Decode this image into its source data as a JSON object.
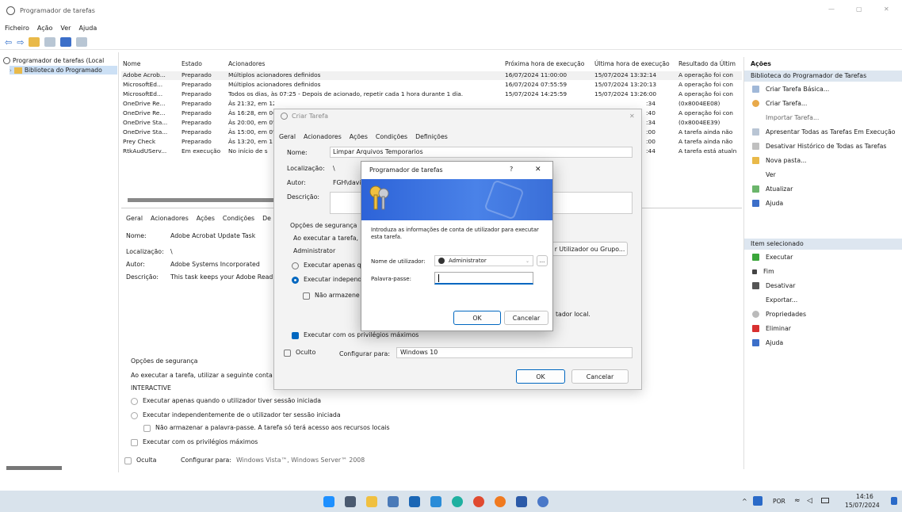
{
  "window": {
    "title": "Programador de tarefas",
    "min": "—",
    "restore": "▢",
    "close": "✕"
  },
  "menu": [
    "Ficheiro",
    "Ação",
    "Ver",
    "Ajuda"
  ],
  "tree": {
    "root": "Programador de tarefas (Local",
    "child": "Biblioteca do Programado"
  },
  "table": {
    "columns": [
      "Nome",
      "Estado",
      "Acionadores",
      "Próxima hora de execução",
      "Última hora de execução",
      "Resultado da Últim"
    ],
    "rows": [
      [
        "Adobe Acrob...",
        "Preparado",
        "Múltiplos acionadores definidos",
        "16/07/2024 11:00:00",
        "15/07/2024 13:32:14",
        "A operação foi con"
      ],
      [
        "MicrosoftEd...",
        "Preparado",
        "Múltiplos acionadores definidos",
        "16/07/2024 07:55:59",
        "15/07/2024 13:20:13",
        "A operação foi con"
      ],
      [
        "MicrosoftEd...",
        "Preparado",
        "Todos os dias, às 07:25 - Depois de acionado, repetir cada 1 hora durante 1 dia.",
        "15/07/2024 14:25:59",
        "15/07/2024 13:26:00",
        "A operação foi con"
      ],
      [
        "OneDrive Re...",
        "Preparado",
        "Às 21:32, em 12",
        "",
        ":34",
        "(0x8004EE08)"
      ],
      [
        "OneDrive Re...",
        "Preparado",
        "Às 16:28, em 0(",
        "",
        ":40",
        "A operação foi con"
      ],
      [
        "OneDrive Sta...",
        "Preparado",
        "Às 20:00, em 0'",
        "",
        ":34",
        "(0x8004EE39)"
      ],
      [
        "OneDrive Sta...",
        "Preparado",
        "Às 15:00, em 0'",
        "",
        ":00",
        "A tarefa ainda não"
      ],
      [
        "Prey Check",
        "Preparado",
        "Às 13:20, em 1!",
        "",
        ":00",
        "A tarefa ainda não"
      ],
      [
        "RtkAudUServ...",
        "Em execução",
        "No início de s",
        "",
        ":44",
        "A tarefa está atualn"
      ]
    ]
  },
  "lower": {
    "tabs": [
      "Geral",
      "Acionadores",
      "Ações",
      "Condições",
      "De"
    ],
    "name_label": "Nome:",
    "name_value": "Adobe Acrobat Update Task",
    "loc_label": "Localização:",
    "loc_value": "\\",
    "author_label": "Autor:",
    "author_value": "Adobe Systems Incorporated",
    "desc_label": "Descrição:",
    "desc_value": "This task keeps your Adobe Read",
    "sec_title": "Opções de segurança",
    "sec_text": "Ao executar a tarefa, utilizar a seguinte conta",
    "account": "INTERACTIVE",
    "opt1": "Executar apenas quando o utilizador tiver sessão iniciada",
    "opt2": "Executar independentemente de o utilizador ter sessão iniciada",
    "opt3": "Não armazenar a palavra-passe. A tarefa só terá acesso aos recursos locais",
    "opt4": "Executar com os privilégios máximos",
    "hidden": "Oculta",
    "config_label": "Configurar para:",
    "config_value": "Windows Vista™, Windows Server™ 2008"
  },
  "actions": {
    "title": "Ações",
    "section1": "Biblioteca do Programador de Tarefas",
    "items1": [
      "Criar Tarefa Básica...",
      "Criar Tarefa...",
      "Importar Tarefa...",
      "Apresentar Todas as Tarefas Em Execução",
      "Desativar Histórico de Todas as Tarefas",
      "Nova pasta...",
      "Ver",
      "Atualizar",
      "Ajuda"
    ],
    "section2": "Item selecionado",
    "items2": [
      "Executar",
      "Fim",
      "Desativar",
      "Exportar...",
      "Propriedades",
      "Eliminar",
      "Ajuda"
    ]
  },
  "criar": {
    "title": "Criar Tarefa",
    "tabs": [
      "Geral",
      "Acionadores",
      "Ações",
      "Condições",
      "Definições"
    ],
    "name_label": "Nome:",
    "name_value": "Limpar Arquivos Temporarios",
    "loc_label": "Localização:",
    "loc_value": "\\",
    "author_label": "Autor:",
    "author_value": "FGH\\david",
    "desc_label": "Descrição:",
    "sec_title": "Opções de segurança",
    "sec_text": "Ao executar a tarefa, uti",
    "account": "Administrator",
    "change_btn": "r Utilizador ou Grupo...",
    "opt1": "Executar apenas qua",
    "opt2": "Executar independer",
    "opt3": "Não armazene a",
    "opt3_suffix": "tador local.",
    "opt4": "Executar com os privilégios máximos",
    "hidden": "Oculto",
    "config_label": "Configurar para:",
    "config_value": "Windows 10",
    "ok": "OK",
    "cancel": "Cancelar"
  },
  "cred": {
    "title": "Programador de tarefas",
    "help": "?",
    "close": "✕",
    "prompt": "Introduza as informações de conta de utilizador para executar esta tarefa.",
    "user_label": "Nome de utilizador:",
    "user_value": "Administrator",
    "browse": "...",
    "pass_label": "Palavra-passe:",
    "ok": "OK",
    "cancel": "Cancelar"
  },
  "taskbar": {
    "lang": "POR",
    "time": "14:16",
    "date": "15/07/2024"
  },
  "colors": {
    "accent": "#0067c0",
    "blue_banner": "#3a6fd8",
    "selected_bg": "#dde6f0"
  }
}
